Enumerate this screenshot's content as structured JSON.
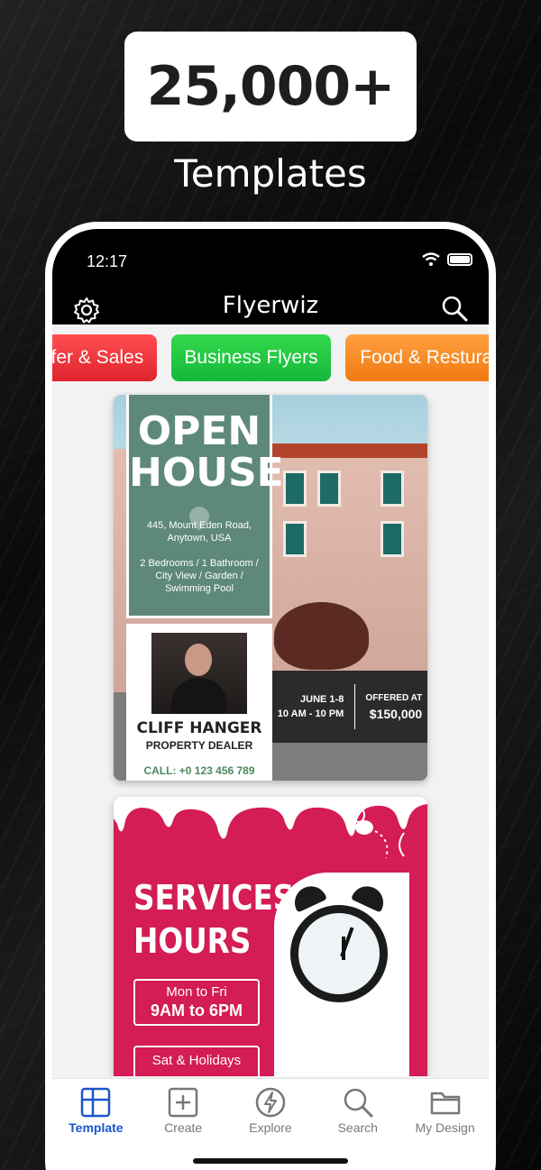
{
  "promo": {
    "headline": "25,000+",
    "subheadline": "Templates"
  },
  "status_bar": {
    "time": "12:17"
  },
  "app": {
    "title": "Flyerwiz",
    "settings_icon": "gear-icon",
    "search_icon": "search-icon"
  },
  "categories": [
    {
      "label": "Offer & Sales",
      "color": "#e9313a"
    },
    {
      "label": "Business Flyers",
      "color": "#22c742"
    },
    {
      "label": "Food & Resturant",
      "color": "#f58a22"
    }
  ],
  "templates": {
    "open_house": {
      "title_1": "OPEN",
      "title_2": "HOUSE",
      "address_1": "445, Mount Eden Road,",
      "address_2": "Anytown, USA",
      "features_1": "2 Bedrooms / 1 Bathroom /",
      "features_2": "City View / Garden /",
      "features_3": "Swimming Pool",
      "agent_name": "CLIFF HANGER",
      "agent_role": "PROPERTY DEALER",
      "agent_call": "CALL: +0 123 456 789",
      "date": "JUNE 1-8",
      "hours": "10 AM - 10 PM",
      "offered_label": "OFFERED AT",
      "price": "$150,000"
    },
    "services_hours": {
      "title_1": "SERVICES",
      "title_2": "HOURS",
      "weekday_label": "Mon to Fri",
      "weekday_hours": "9AM to 6PM",
      "weekend_label": "Sat & Holidays"
    }
  },
  "bottom_nav": [
    {
      "label": "Template",
      "icon": "template-grid-icon",
      "active": true
    },
    {
      "label": "Create",
      "icon": "plus-square-icon",
      "active": false
    },
    {
      "label": "Explore",
      "icon": "lightning-icon",
      "active": false
    },
    {
      "label": "Search",
      "icon": "search-icon",
      "active": false
    },
    {
      "label": "My Design",
      "icon": "folder-icon",
      "active": false
    }
  ]
}
